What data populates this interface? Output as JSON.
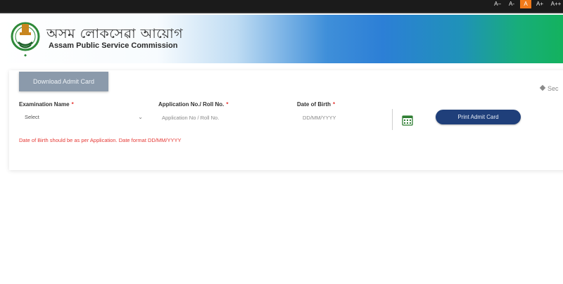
{
  "topbar": {
    "font_controls": [
      {
        "label": "A–",
        "active": false
      },
      {
        "label": "A-",
        "active": false
      },
      {
        "label": "A",
        "active": true
      },
      {
        "label": "A+",
        "active": false
      },
      {
        "label": "A++",
        "active": false
      }
    ]
  },
  "header": {
    "title_assamese": "অসম লোকসেৱা আয়োগ",
    "title_english": "Assam Public Service Commission"
  },
  "card": {
    "download_tab_label": "Download Admit Card",
    "side_link_label": "Sec",
    "exam_label": "Examination Name",
    "exam_selected": "Select",
    "app_label": "Application No./ Roll No.",
    "app_placeholder": "Application No / Roll No.",
    "dob_label": "Date of Birth",
    "dob_placeholder": "DD/MM/YYYY",
    "required_mark": "*",
    "print_button_label": "Print Admit Card",
    "error_message": "Date of Birth should be as per Application. Date format DD/MM/YYYY"
  },
  "colors": {
    "accent_primary": "#1f3f7a",
    "error": "#e53935",
    "active_font_control": "#f07a1a"
  },
  "icons": {
    "emblem": "government-emblem-icon",
    "calendar": "calendar-icon",
    "chevron": "chevron-down-icon"
  }
}
